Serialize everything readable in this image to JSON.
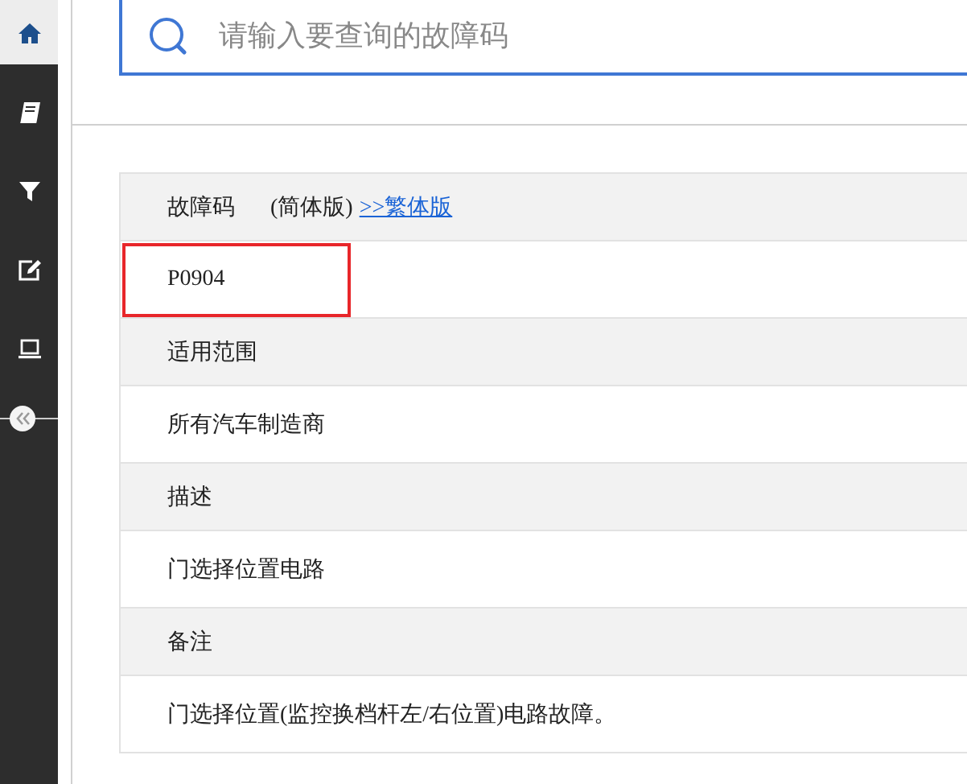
{
  "sidebar": {
    "items": [
      {
        "selected": true
      },
      {
        "selected": false
      },
      {
        "selected": false
      },
      {
        "selected": false
      },
      {
        "selected": false
      }
    ]
  },
  "search": {
    "placeholder": "请输入要查询的故障码"
  },
  "table": {
    "rows": [
      {
        "kind": "header",
        "text": "故障码",
        "note": "(简体版)",
        "link": ">>繁体版",
        "highlighted": false
      },
      {
        "kind": "value",
        "text": "P0904",
        "highlighted": true
      },
      {
        "kind": "header",
        "text": "适用范围",
        "highlighted": false
      },
      {
        "kind": "value",
        "text": "所有汽车制造商",
        "highlighted": false
      },
      {
        "kind": "header",
        "text": "描述",
        "highlighted": false
      },
      {
        "kind": "value",
        "text": "门选择位置电路",
        "highlighted": false
      },
      {
        "kind": "header",
        "text": "备注",
        "highlighted": false
      },
      {
        "kind": "value",
        "text": "门选择位置(监控换档杆左/右位置)电路故障。",
        "highlighted": false
      }
    ]
  }
}
